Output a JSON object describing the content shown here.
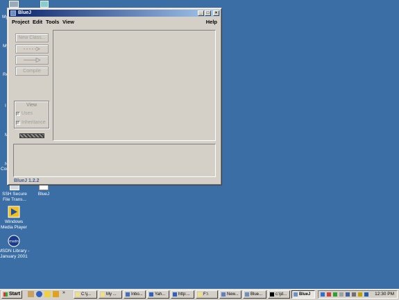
{
  "desktop": {
    "icons": [
      {
        "label": "SSH Secure File Trans...",
        "line1": "SSH Secure",
        "line2": "File Trans..."
      },
      {
        "label": "BlueJ",
        "line1": "BlueJ",
        "line2": ""
      },
      {
        "label": "Windows Media Player",
        "line1": "Windows",
        "line2": "Media Player"
      },
      {
        "label": "MSDN Library - January 2001",
        "line1": "MSDN Library -",
        "line2": "January 2001"
      }
    ],
    "partial_labels": [
      "My",
      "My",
      "Re",
      "I",
      "M",
      "N",
      "Con"
    ]
  },
  "window": {
    "title": "BlueJ",
    "controls": {
      "minimize": "_",
      "maximize": "□",
      "close": "×"
    },
    "menu": [
      "Project",
      "Edit",
      "Tools",
      "View"
    ],
    "help": "Help",
    "tools": {
      "new_class": "New Class...",
      "compile": "Compile"
    },
    "view_panel": {
      "title": "View",
      "uses": "Uses",
      "inheritance": "Inheritance",
      "uses_checked": true,
      "inheritance_checked": true
    },
    "version": "BlueJ 1.2.2"
  },
  "taskbar": {
    "start": "Start",
    "tasks": [
      "C:\\j...",
      "My ...",
      "Inbo...",
      "Yah...",
      "http:...",
      "F:\\",
      "New...",
      "Blue...",
      "c:\\jd...",
      "BlueJ"
    ],
    "active_task": "BlueJ",
    "quick_launch_more": "»",
    "clock": "12:30 PM"
  },
  "colors": {
    "desktop": "#3a6ea5",
    "titlebar_start": "#0a246a",
    "titlebar_end": "#a6caf0",
    "face": "#d4d0c8"
  }
}
